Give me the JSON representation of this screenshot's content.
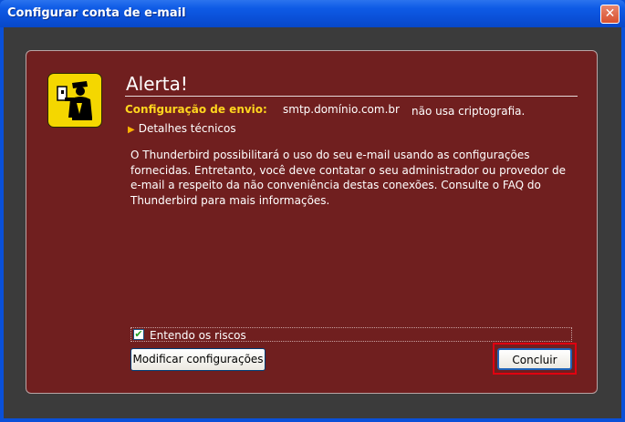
{
  "window": {
    "title": "Configurar conta de e-mail",
    "close_glyph": "✕"
  },
  "alert": {
    "heading": "Alerta!",
    "config_label": "Configuração de envio:",
    "server": "smtp.domínio.com.br",
    "note": "não usa criptografia.",
    "technical_details": "Detalhes técnicos",
    "expand_glyph": "▶",
    "message": "O Thunderbird possibilitará o uso do seu e-mail usando as configurações fornecidas. Entretanto, você deve contatar o seu administrador ou provedor de e-mail a respeito da não conveniência destas conexões. Consulte o FAQ do Thunderbird para mais informações."
  },
  "risk": {
    "label": "Entendo os riscos",
    "checked": true,
    "check_glyph": "✔"
  },
  "buttons": {
    "modify": "Modificar configurações",
    "done": "Concluir"
  },
  "icons": {
    "warning": "guard-icon"
  },
  "colors": {
    "panel": "#701f1f",
    "accent": "#ffd51e",
    "icon_bg": "#f4d700",
    "highlight": "#e00010"
  }
}
